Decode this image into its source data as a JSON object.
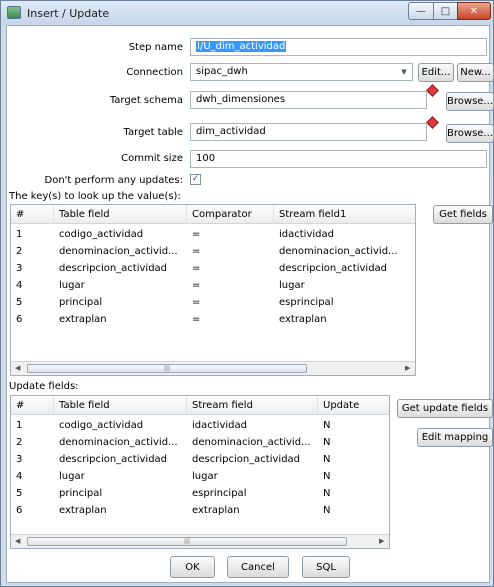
{
  "window": {
    "title": "Insert / Update"
  },
  "form": {
    "step_name_label": "Step name",
    "step_name_value": "I/U_dim_actividad",
    "connection_label": "Connection",
    "connection_value": "sipac_dwh",
    "edit_label": "Edit...",
    "new_label": "New...",
    "target_schema_label": "Target schema",
    "target_schema_value": "dwh_dimensiones",
    "browse_label": "Browse...",
    "target_table_label": "Target table",
    "target_table_value": "dim_actividad",
    "commit_size_label": "Commit size",
    "commit_size_value": "100",
    "dont_update_label": "Don't perform any updates:",
    "dont_update_checked": true,
    "keys_label": "The key(s) to look up the value(s):"
  },
  "keys_table": {
    "columns": [
      "#",
      "Table field",
      "Comparator",
      "Stream field1"
    ],
    "rows": [
      [
        "1",
        "codigo_actividad",
        "=",
        "idactividad"
      ],
      [
        "2",
        "denominacion_activid...",
        "=",
        "denominacion_activid..."
      ],
      [
        "3",
        "descripcion_actividad",
        "=",
        "descripcion_actividad"
      ],
      [
        "4",
        "lugar",
        "=",
        "lugar"
      ],
      [
        "5",
        "principal",
        "=",
        "esprincipal"
      ],
      [
        "6",
        "extraplan",
        "=",
        "extraplan"
      ]
    ],
    "scroll_grip": "|||"
  },
  "get_fields_label": "Get fields",
  "update_fields_label": "Update fields:",
  "update_table": {
    "columns": [
      "#",
      "Table field",
      "Stream field",
      "Update"
    ],
    "rows": [
      [
        "1",
        "codigo_actividad",
        "idactividad",
        "N"
      ],
      [
        "2",
        "denominacion_activid...",
        "denominacion_activid...",
        "N"
      ],
      [
        "3",
        "descripcion_actividad",
        "descripcion_actividad",
        "N"
      ],
      [
        "4",
        "lugar",
        "lugar",
        "N"
      ],
      [
        "5",
        "principal",
        "esprincipal",
        "N"
      ],
      [
        "6",
        "extraplan",
        "extraplan",
        "N"
      ]
    ],
    "scroll_grip": "|||"
  },
  "get_update_fields_label": "Get update fields",
  "edit_mapping_label": "Edit mapping",
  "footer": {
    "ok": "OK",
    "cancel": "Cancel",
    "sql": "SQL"
  },
  "colors": {
    "selection": "#3399ff",
    "required_marker": "#d93b3b"
  }
}
